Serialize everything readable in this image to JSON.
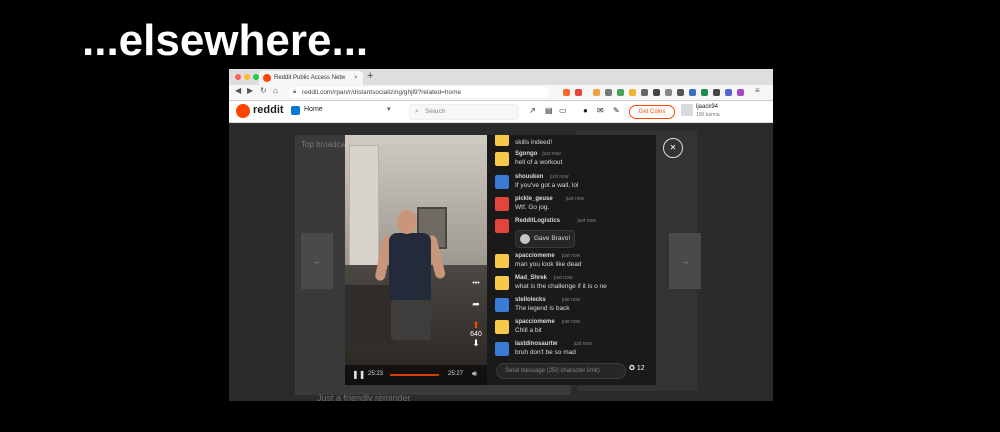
{
  "slide": {
    "title": "...elsewhere..."
  },
  "browser": {
    "tab_title": "Reddit Public Access Netw",
    "tab_close": "×",
    "new_tab": "+",
    "url": "reddit.com/rpan/r/distantsocializing/ghjl9?related=home"
  },
  "reddit": {
    "logo_text": "reddit",
    "home_label": "Home",
    "search_placeholder": "Search",
    "coins_label": "Get Coins",
    "username": "ljaack94",
    "karma": "190 karma",
    "bg_title": "Top broadcasts",
    "bg_bottom": "Just a friendly reminder"
  },
  "video": {
    "current_time": "25:23",
    "duration": "25:27",
    "vote_count": "640",
    "progress_fraction": 0.95
  },
  "chat": {
    "messages": [
      {
        "user": "",
        "time": "",
        "text": "skills indeed!",
        "color": "#f6c94a"
      },
      {
        "user": "Sgongo",
        "time": "just now",
        "text": "hell of a workout",
        "color": "#f6c94a"
      },
      {
        "user": "shouuken",
        "time": "just now",
        "text": "If you've got a wall, lol",
        "color": "#3a7bd5"
      },
      {
        "user": "pickle_geuse",
        "time": "just now",
        "text": "Wtf. Go jog.",
        "color": "#e2453c"
      },
      {
        "user": "RedditLogistics",
        "time": "just now",
        "text": "",
        "color": "#e2453c"
      },
      {
        "user": "spacciomeme",
        "time": "just now",
        "text": "man you look like dead",
        "color": "#f6c94a"
      },
      {
        "user": "Mad_Shrek",
        "time": "just now",
        "text": "what is the challenge if it is o ne",
        "color": "#f6c94a"
      },
      {
        "user": "stellolecks",
        "time": "just now",
        "text": "The legend is back",
        "color": "#3a7bd5"
      },
      {
        "user": "spacciomeme",
        "time": "just now",
        "text": "Chill a bit",
        "color": "#f6c94a"
      },
      {
        "user": "lastdinosaurtw",
        "time": "just now",
        "text": "bruh don't be so mad",
        "color": "#3a7bd5"
      }
    ],
    "award_text": "Gave Bravo!",
    "input_placeholder": "Send message (250 character limit)",
    "coins_count": "12"
  },
  "colors": {
    "accent": "#ff4500",
    "reddit_blue": "#0079d3"
  }
}
